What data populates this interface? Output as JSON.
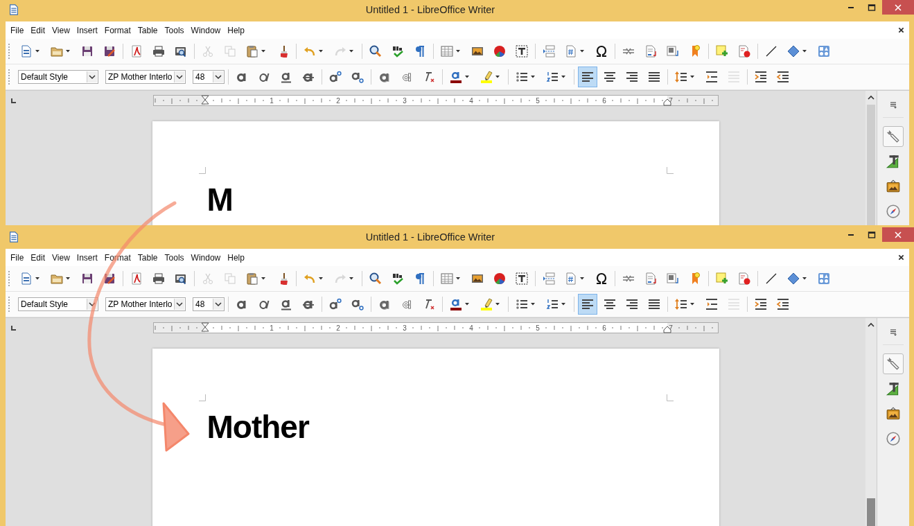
{
  "windows": [
    {
      "title": "Untitled 1 - LibreOffice Writer",
      "menu": [
        "File",
        "Edit",
        "View",
        "Insert",
        "Format",
        "Table",
        "Tools",
        "Window",
        "Help"
      ],
      "standard_toolbar": [
        {
          "disabled": false
        },
        {
          "disabled": false
        },
        {
          "disabled": false
        },
        {
          "disabled": false
        },
        {
          "disabled": false
        },
        {
          "disabled": false
        },
        {
          "disabled": false
        },
        {
          "disabled": true
        },
        {
          "disabled": true
        },
        {
          "disabled": false
        },
        {
          "disabled": false
        },
        {
          "disabled": false
        },
        {
          "disabled": true
        },
        {
          "disabled": false
        },
        {
          "disabled": false
        },
        {
          "disabled": false
        },
        {
          "disabled": false
        },
        {
          "disabled": false
        },
        {
          "disabled": false
        },
        {
          "disabled": false
        },
        {
          "disabled": false
        },
        {
          "disabled": false
        },
        {
          "disabled": false
        },
        {
          "disabled": false
        },
        {
          "disabled": false
        },
        {
          "disabled": false
        },
        {
          "disabled": false
        },
        {
          "disabled": false
        },
        {
          "disabled": false
        },
        {
          "disabled": false
        },
        {
          "disabled": false
        },
        {
          "disabled": false
        }
      ],
      "formatting_toolbar": {
        "paragraph_style": "Default Style",
        "font_name": "ZP Mother Interlo",
        "font_size": "48",
        "buttons": [
          {
            "disabled": false
          },
          {
            "disabled": false
          },
          {
            "disabled": false
          },
          {
            "disabled": false
          },
          {
            "disabled": false
          },
          {
            "disabled": false
          },
          {
            "disabled": false
          },
          {
            "disabled": false
          },
          {
            "disabled": false
          },
          {
            "disabled": false
          },
          {
            "disabled": false
          },
          {
            "disabled": false
          },
          {
            "disabled": false
          },
          {
            "disabled": false
          },
          {
            "disabled": false
          },
          {
            "disabled": true
          },
          {
            "disabled": false
          },
          {
            "disabled": false
          }
        ],
        "alignment": [
          {
            "selected": true
          },
          {
            "selected": false
          },
          {
            "selected": false
          },
          {
            "selected": false
          }
        ]
      },
      "ruler_labels": [
        "1",
        "2",
        "3",
        "4",
        "5",
        "6",
        "7"
      ],
      "document_text": "M",
      "sidebar_tabs": [
        {
          "selected": true
        },
        {
          "selected": false
        },
        {
          "selected": false
        },
        {
          "selected": false
        }
      ]
    },
    {
      "title": "Untitled 1 - LibreOffice Writer",
      "menu": [
        "File",
        "Edit",
        "View",
        "Insert",
        "Format",
        "Table",
        "Tools",
        "Window",
        "Help"
      ],
      "standard_toolbar": [
        {
          "disabled": false
        },
        {
          "disabled": false
        },
        {
          "disabled": false
        },
        {
          "disabled": false
        },
        {
          "disabled": false
        },
        {
          "disabled": false
        },
        {
          "disabled": false
        },
        {
          "disabled": true
        },
        {
          "disabled": true
        },
        {
          "disabled": false
        },
        {
          "disabled": false
        },
        {
          "disabled": false
        },
        {
          "disabled": true
        },
        {
          "disabled": false
        },
        {
          "disabled": false
        },
        {
          "disabled": false
        },
        {
          "disabled": false
        },
        {
          "disabled": false
        },
        {
          "disabled": false
        },
        {
          "disabled": false
        },
        {
          "disabled": false
        },
        {
          "disabled": false
        },
        {
          "disabled": false
        },
        {
          "disabled": false
        },
        {
          "disabled": false
        },
        {
          "disabled": false
        },
        {
          "disabled": false
        },
        {
          "disabled": false
        },
        {
          "disabled": false
        },
        {
          "disabled": false
        },
        {
          "disabled": false
        },
        {
          "disabled": false
        }
      ],
      "formatting_toolbar": {
        "paragraph_style": "Default Style",
        "font_name": "ZP Mother Interlo",
        "font_size": "48",
        "buttons": [
          {
            "disabled": false
          },
          {
            "disabled": false
          },
          {
            "disabled": false
          },
          {
            "disabled": false
          },
          {
            "disabled": false
          },
          {
            "disabled": false
          },
          {
            "disabled": false
          },
          {
            "disabled": false
          },
          {
            "disabled": false
          },
          {
            "disabled": false
          },
          {
            "disabled": false
          },
          {
            "disabled": false
          },
          {
            "disabled": false
          },
          {
            "disabled": false
          },
          {
            "disabled": false
          },
          {
            "disabled": true
          },
          {
            "disabled": false
          },
          {
            "disabled": false
          }
        ],
        "alignment": [
          {
            "selected": true
          },
          {
            "selected": false
          },
          {
            "selected": false
          },
          {
            "selected": false
          }
        ]
      },
      "ruler_labels": [
        "1",
        "2",
        "3",
        "4",
        "5",
        "6",
        "7"
      ],
      "document_text": "Mother",
      "sidebar_tabs": [
        {
          "selected": true
        },
        {
          "selected": false
        },
        {
          "selected": false
        },
        {
          "selected": false
        }
      ]
    }
  ]
}
